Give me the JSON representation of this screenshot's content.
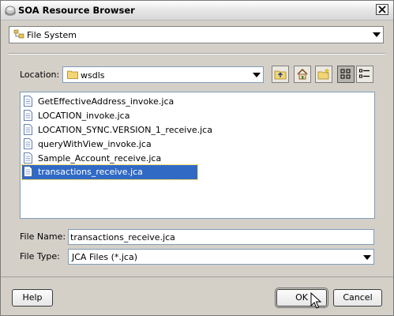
{
  "window": {
    "title": "SOA Resource Browser"
  },
  "source_combo": {
    "selected": "File System"
  },
  "location": {
    "label": "Location:",
    "selected": "wsdls"
  },
  "toolbar": {
    "buttons": [
      "up-folder-icon",
      "home-icon",
      "new-folder-icon",
      "list-view-icon",
      "details-view-icon"
    ],
    "active_view": "list-view"
  },
  "files": [
    {
      "name": "GetEffectiveAddress_invoke.jca",
      "selected": false
    },
    {
      "name": "LOCATION_invoke.jca",
      "selected": false
    },
    {
      "name": "LOCATION_SYNC.VERSION_1_receive.jca",
      "selected": false
    },
    {
      "name": "queryWithView_invoke.jca",
      "selected": false
    },
    {
      "name": "Sample_Account_receive.jca",
      "selected": false
    },
    {
      "name": "transactions_receive.jca",
      "selected": true
    }
  ],
  "file_name": {
    "label": "File Name:",
    "value": "transactions_receive.jca"
  },
  "file_type": {
    "label": "File Type:",
    "selected": "JCA Files (*.jca)"
  },
  "buttons": {
    "help": "Help",
    "ok": "OK",
    "cancel": "Cancel"
  },
  "colors": {
    "selection": "#316ac5",
    "dialog_bg": "#d4d0c8",
    "focus_outline": "#ffc000"
  }
}
